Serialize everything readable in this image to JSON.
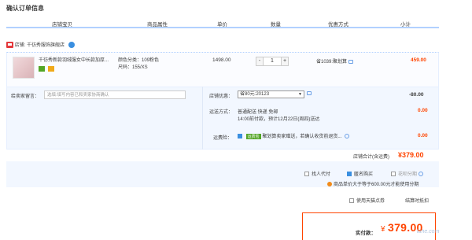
{
  "page": {
    "title": "确认订单信息"
  },
  "columns": [
    "店铺宝贝",
    "商品属性",
    "单价",
    "数量",
    "优惠方式",
    "小计"
  ],
  "shop": {
    "label": "店铺:",
    "name": "千彷秀服饰旗舰店"
  },
  "item": {
    "name": "千彷秀新款羽绒服女中长款加厚...",
    "attr_color": "颜色分类：109粉色",
    "attr_size": "尺码：155/XS",
    "unit_price": "1498.00",
    "qty_minus": "-",
    "qty_value": "1",
    "qty_plus": "+",
    "discount": "省1039:聚划算",
    "subtotal": "459.00"
  },
  "message": {
    "label": "给卖家留言：",
    "placeholder": "选填:填写内容已和卖家协商确认"
  },
  "coupon": {
    "label": "店铺优惠：",
    "selected": "省80元:20123",
    "amount": "-80.00"
  },
  "shipping": {
    "label": "运送方式：",
    "method": "普通配送 快递 免邮",
    "eta": "14:00前付款，预计12月22日(周四)送达",
    "amount": "0.00"
  },
  "insurance": {
    "label": "运费险：",
    "tag": "运费险",
    "text": "聚划算卖家赠送，若确认收货前退货...",
    "amount": "0.00"
  },
  "shop_total": {
    "label": "店铺合计(含运费)",
    "value": "¥379.00"
  },
  "options": {
    "proxy_pay": "找人代付",
    "anonymous": "匿名购买",
    "installment": "花呗分期",
    "installment_note": "商品单价大于等于600.00元才能使用分期",
    "tmall_points": "使用天猫点券",
    "settlement": "结算时抵扣"
  },
  "payment": {
    "label": "实付款：",
    "currency": "¥",
    "value": "379.00"
  },
  "watermark": "luhe.com"
}
